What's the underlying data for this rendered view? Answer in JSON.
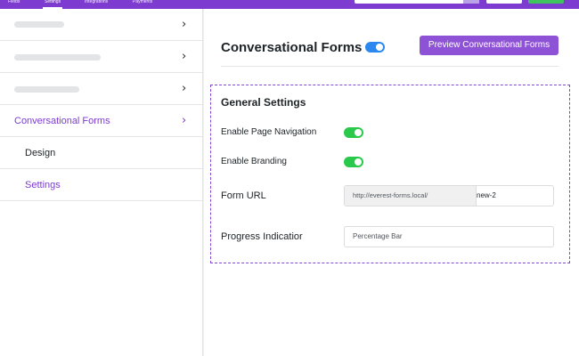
{
  "topbar": {
    "tabs": [
      {
        "label": "Fields",
        "active": false
      },
      {
        "label": "Settings",
        "active": true
      },
      {
        "label": "Integrations",
        "active": false
      },
      {
        "label": "Payments",
        "active": false
      }
    ],
    "accent_color": "#7e3bd0"
  },
  "sidebar": {
    "items": [
      {
        "label": "",
        "placeholder": true,
        "chevron": "chevron-right-icon"
      },
      {
        "label": "",
        "placeholder": true,
        "chevron": "chevron-right-icon"
      },
      {
        "label": "",
        "placeholder": true,
        "chevron": "chevron-right-icon"
      },
      {
        "label": "Conversational Forms",
        "active": true,
        "chevron": "chevron-right-icon"
      }
    ],
    "subitems": [
      {
        "label": "Design",
        "active": false
      },
      {
        "label": "Settings",
        "active": true
      }
    ]
  },
  "header": {
    "title": "Conversational Forms",
    "enabled": true,
    "preview_button": "Preview Conversational Forms"
  },
  "general_settings": {
    "title": "General Settings",
    "page_navigation": {
      "label": "Enable Page Navigation",
      "enabled": true
    },
    "branding": {
      "label": "Enable Branding",
      "enabled": true
    },
    "form_url": {
      "label": "Form URL",
      "prefix": "http://everest-forms.local/",
      "slug": "new-2"
    },
    "progress_indicator": {
      "label": "Progress Indicatior",
      "value": "Percentage Bar"
    }
  },
  "colors": {
    "purple": "#7e3bd0",
    "toggle_blue": "#2b88ee",
    "toggle_green": "#2bc94b"
  }
}
